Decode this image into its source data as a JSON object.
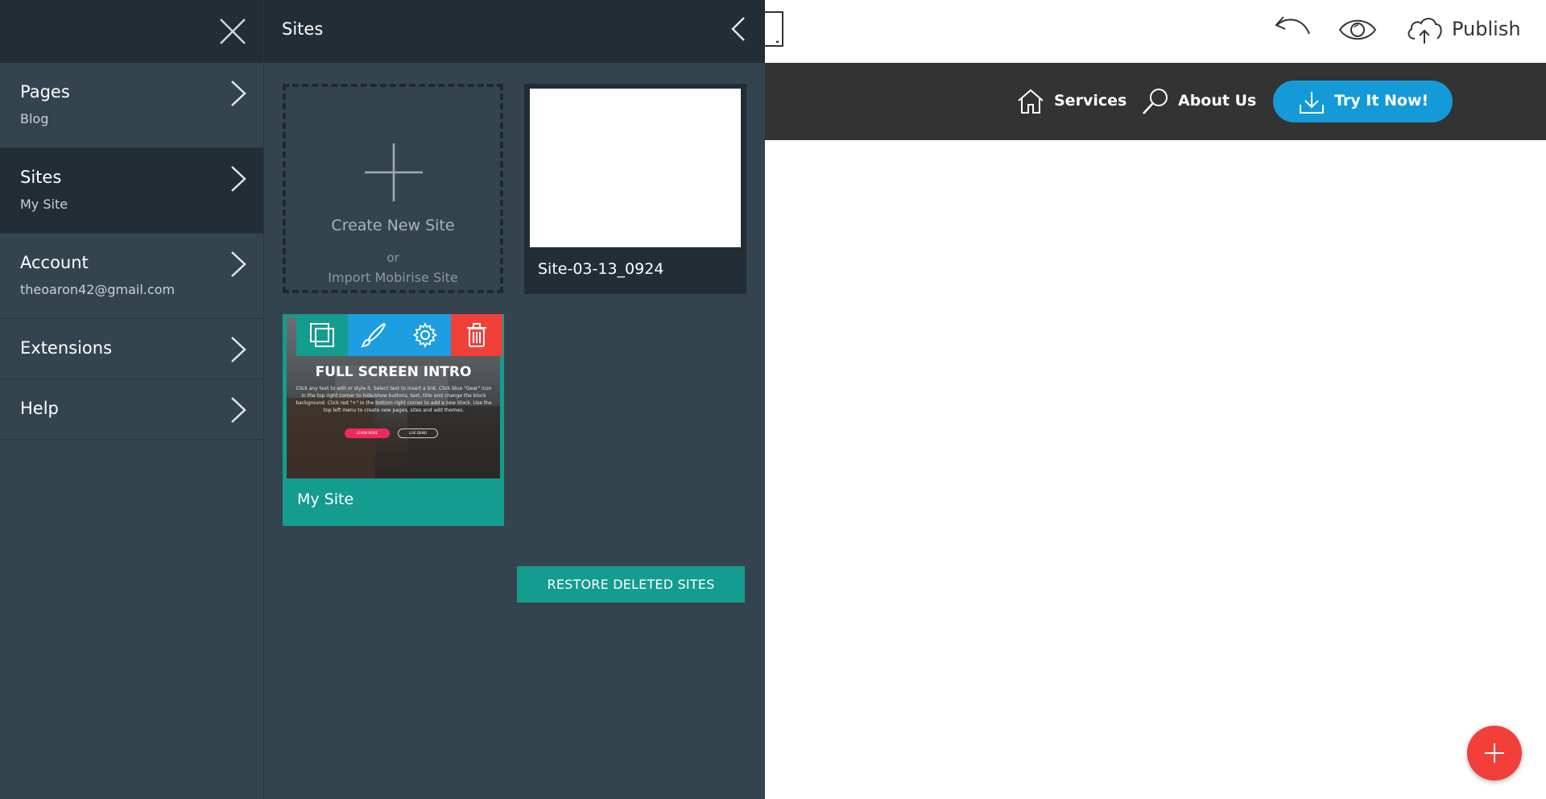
{
  "left_menu": {
    "items": [
      {
        "label": "Pages",
        "sub": "Blog"
      },
      {
        "label": "Sites",
        "sub": "My Site"
      },
      {
        "label": "Account",
        "sub": "theoaron42@gmail.com"
      },
      {
        "label": "Extensions"
      },
      {
        "label": "Help"
      }
    ],
    "active": "Sites"
  },
  "sites_panel": {
    "title": "Sites",
    "create": {
      "label": "Create New Site",
      "or": "or",
      "import": "Import Mobirise Site"
    },
    "sites": [
      {
        "name": "Site-03-13_0924"
      },
      {
        "name": "My Site"
      }
    ],
    "preview": {
      "title": "FULL SCREEN INTRO",
      "text": "Click any text to edit or style it. Select text to insert a link. Click blue \"Gear\" icon in the top right corner to hide/show buttons, text, title and change the block background. Click red \"+\" in the bottom right corner to add a new block. Use the top left menu to create new pages, sites and add themes.",
      "btn_primary": "LEARN MORE",
      "btn_secondary": "LIVE DEMO"
    },
    "restore_button": "RESTORE DELETED SITES"
  },
  "toolbar": {
    "publish_label": "Publish"
  },
  "site_nav": {
    "links": [
      "Services",
      "About Us"
    ],
    "cta": "Try It Now!"
  },
  "colors": {
    "sidebar_bg": "#34444f",
    "header_bg": "#232d35",
    "teal": "#149c8e",
    "blue": "#149bd7",
    "red": "#f23f3a",
    "nav_bg": "#333333"
  }
}
